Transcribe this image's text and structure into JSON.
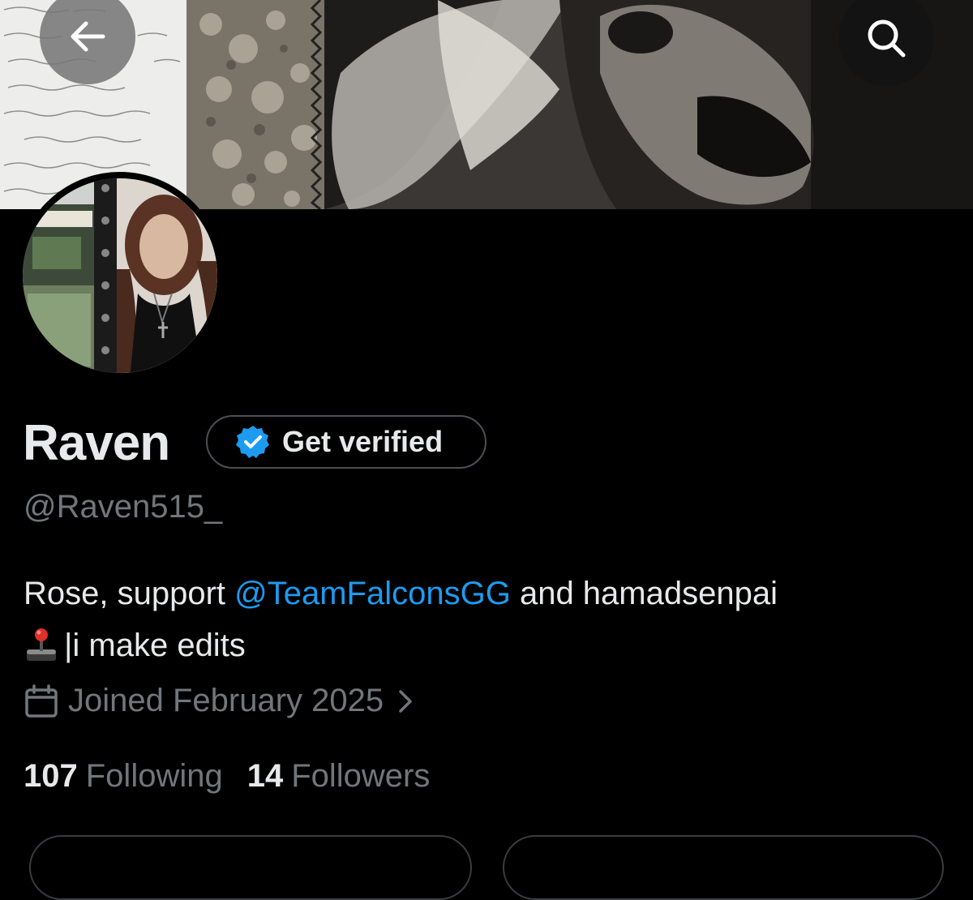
{
  "header": {
    "back_icon": "arrow-left-icon",
    "search_icon": "search-icon"
  },
  "profile": {
    "display_name": "Raven",
    "verify_button_label": "Get verified",
    "verify_icon": "verified-badge-icon",
    "verify_color": "#1d9bf0",
    "handle": "@Raven515_",
    "bio": {
      "text_before": "Rose, support ",
      "mention": "@TeamFalconsGG",
      "text_after": " and hamadsenpai",
      "emoji_icon": "joystick-icon",
      "line2": "|i make edits"
    },
    "joined": {
      "icon": "calendar-icon",
      "text": "Joined February 2025"
    },
    "stats": {
      "following_count": "107",
      "following_label": "Following",
      "followers_count": "14",
      "followers_label": "Followers"
    }
  },
  "colors": {
    "background": "#000000",
    "primary_text": "#e7e9ea",
    "secondary_text": "#71767b",
    "link": "#1d9bf0"
  }
}
